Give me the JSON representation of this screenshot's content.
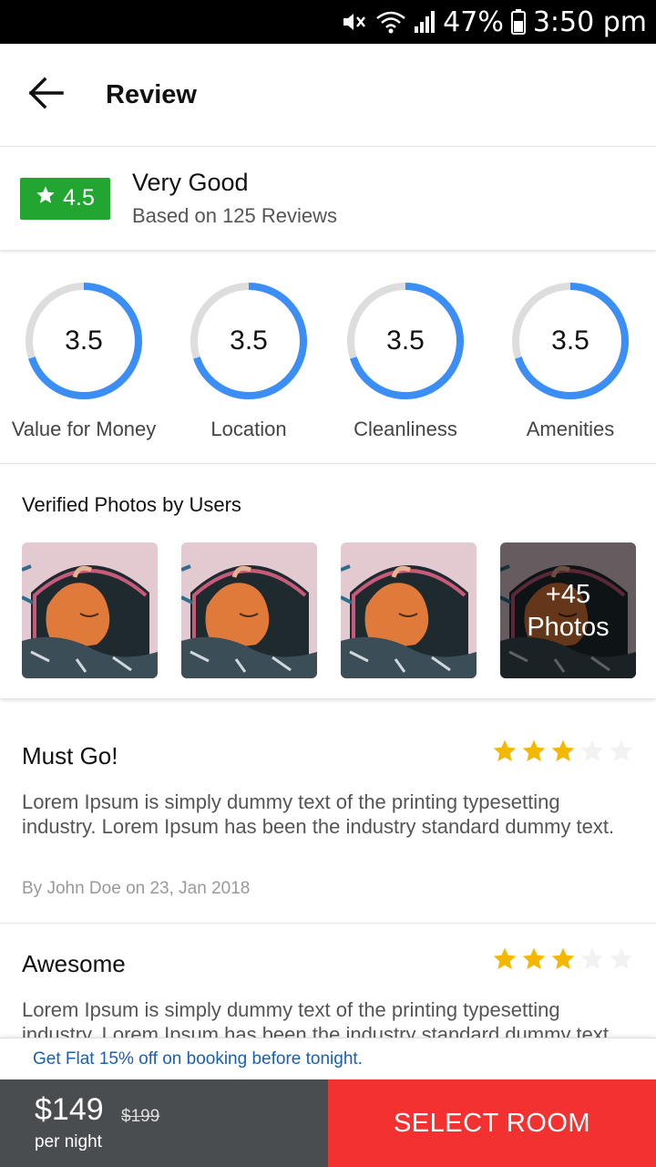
{
  "status_bar": {
    "battery": "47%",
    "time": "3:50 pm"
  },
  "header": {
    "title": "Review",
    "back_icon": "arrow-left-icon"
  },
  "summary": {
    "rating": "4.5",
    "label": "Very Good",
    "subtitle": "Based on 125 Reviews",
    "badge_color": "#22a531"
  },
  "categories": [
    {
      "label": "Value for Money",
      "value": "3.5",
      "progress": 0.7
    },
    {
      "label": "Location",
      "value": "3.5",
      "progress": 0.7
    },
    {
      "label": "Cleanliness",
      "value": "3.5",
      "progress": 0.7
    },
    {
      "label": "Amenities",
      "value": "3.5",
      "progress": 0.7
    }
  ],
  "ring_color": "#3a8ef6",
  "photos": {
    "title": "Verified Photos by Users",
    "more_count": "+45",
    "more_label": "Photos"
  },
  "reviews": [
    {
      "title": "Must Go!",
      "stars": 3,
      "body": "Lorem Ipsum is simply dummy text of the printing typesetting industry. Lorem Ipsum has been the industry standard dummy text.",
      "meta": "By John Doe on 23, Jan 2018"
    },
    {
      "title": "Awesome",
      "stars": 3,
      "body": "Lorem Ipsum is simply dummy text of the printing typesetting industry. Lorem Ipsum has been the industry standard dummy text."
    }
  ],
  "star_color": "#f5b800",
  "offer": {
    "text": "Get Flat 15% off on booking before tonight."
  },
  "booking": {
    "price": "$149",
    "old_price": "$199",
    "unit": "per night",
    "button_label": "SELECT ROOM",
    "button_color": "#f23130"
  }
}
